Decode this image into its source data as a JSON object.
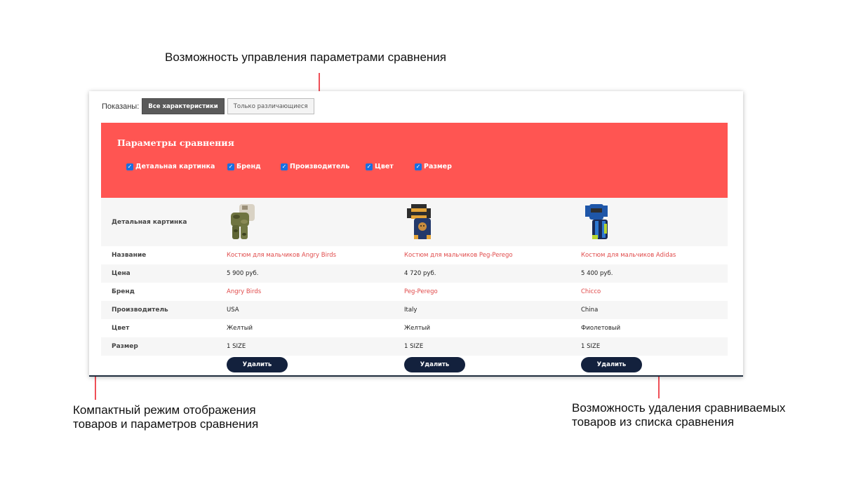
{
  "annotations": {
    "top": "Возможность управления параметрами сравнения",
    "left_line1": "Компактный режим отображения",
    "left_line2": "товаров и параметров сравнения",
    "right_line1": "Возможность удаления сравниваемых",
    "right_line2": "товаров из списка сравнения",
    "accent_color": "#ef4f57"
  },
  "filter": {
    "label": "Показаны:",
    "all_label": "Все характеристики",
    "diff_label": "Только различающиеся",
    "active": "all"
  },
  "params": {
    "title": "Параметры сравнения",
    "bg_color": "#ff5552",
    "items": [
      {
        "label": "Детальная картинка",
        "checked": true
      },
      {
        "label": "Бренд",
        "checked": true
      },
      {
        "label": "Производитель",
        "checked": true
      },
      {
        "label": "Цвет",
        "checked": true
      },
      {
        "label": "Размер",
        "checked": true
      }
    ]
  },
  "table": {
    "rows": {
      "image": "Детальная картинка",
      "name": "Название",
      "price": "Цена",
      "brand": "Бренд",
      "maker": "Производитель",
      "color": "Цвет",
      "size": "Размер"
    },
    "products": [
      {
        "name": "Костюм для мальчиков Angry Birds",
        "price": "5 900 руб.",
        "brand": "Angry Birds",
        "maker": "USA",
        "color": "Желтый",
        "size": "1 SIZE",
        "image_icon": "camo-outfit-image"
      },
      {
        "name": "Костюм для мальчиков Peg-Perego",
        "price": "4 720 руб.",
        "brand": "Peg-Perego",
        "maker": "Italy",
        "color": "Желтый",
        "size": "1 SIZE",
        "image_icon": "striped-outfit-image"
      },
      {
        "name": "Костюм для мальчиков Adidas",
        "price": "5 400 руб.",
        "brand": "Chicco",
        "maker": "China",
        "color": "Фиолетовый",
        "size": "1 SIZE",
        "image_icon": "tracksuit-image"
      }
    ],
    "delete_label": "Удалить",
    "link_color": "#e04a4a",
    "button_color": "#13213d"
  }
}
